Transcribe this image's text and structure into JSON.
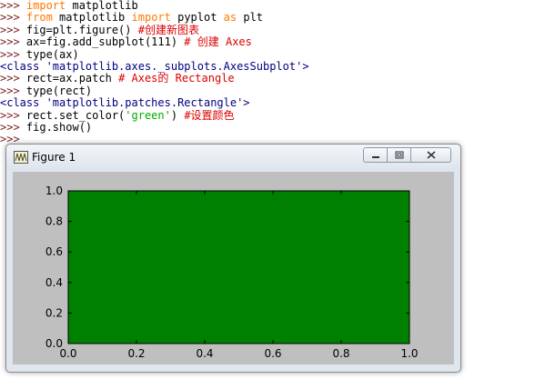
{
  "shell": {
    "prompt": ">>> ",
    "lines": [
      {
        "type": "in",
        "parts": [
          {
            "t": "import",
            "c": "kw"
          },
          {
            "t": " matplotlib",
            "c": ""
          }
        ]
      },
      {
        "type": "in",
        "parts": [
          {
            "t": "from",
            "c": "kw"
          },
          {
            "t": " matplotlib ",
            "c": ""
          },
          {
            "t": "import",
            "c": "kw"
          },
          {
            "t": " pyplot ",
            "c": ""
          },
          {
            "t": "as",
            "c": "kw"
          },
          {
            "t": " plt",
            "c": ""
          }
        ]
      },
      {
        "type": "in",
        "parts": [
          {
            "t": "fig=plt.figure() ",
            "c": ""
          },
          {
            "t": "#创建新图表",
            "c": "cm"
          }
        ]
      },
      {
        "type": "in",
        "parts": [
          {
            "t": "ax=fig.add_subplot(111) ",
            "c": ""
          },
          {
            "t": "# 创建 Axes",
            "c": "cm"
          }
        ]
      },
      {
        "type": "in",
        "parts": [
          {
            "t": "type(ax)",
            "c": ""
          }
        ]
      },
      {
        "type": "out",
        "parts": [
          {
            "t": "<class 'matplotlib.axes._subplots.AxesSubplot'>",
            "c": "out"
          }
        ]
      },
      {
        "type": "in",
        "parts": [
          {
            "t": "rect=ax.patch ",
            "c": ""
          },
          {
            "t": "# Axes的 Rectangle",
            "c": "cm"
          }
        ]
      },
      {
        "type": "in",
        "parts": [
          {
            "t": "type(rect)",
            "c": ""
          }
        ]
      },
      {
        "type": "out",
        "parts": [
          {
            "t": "<class 'matplotlib.patches.Rectangle'>",
            "c": "out"
          }
        ]
      },
      {
        "type": "in",
        "parts": [
          {
            "t": "rect.set_color(",
            "c": ""
          },
          {
            "t": "'green'",
            "c": "str"
          },
          {
            "t": ") ",
            "c": ""
          },
          {
            "t": "#设置颜色",
            "c": "cm"
          }
        ]
      },
      {
        "type": "in",
        "parts": [
          {
            "t": "fig.show()",
            "c": ""
          }
        ]
      },
      {
        "type": "in",
        "parts": []
      }
    ]
  },
  "window": {
    "title": "Figure 1",
    "icon": "matplotlib-wave-icon",
    "buttons": {
      "minimize": "minimize-icon",
      "maximize": "maximize-icon",
      "close": "close-icon"
    }
  },
  "chart_data": {
    "type": "area",
    "title": "",
    "xlabel": "",
    "ylabel": "",
    "xlim": [
      0.0,
      1.0
    ],
    "ylim": [
      0.0,
      1.0
    ],
    "x_ticks": [
      "0.0",
      "0.2",
      "0.4",
      "0.6",
      "0.8",
      "1.0"
    ],
    "y_ticks": [
      "0.0",
      "0.2",
      "0.4",
      "0.6",
      "0.8",
      "1.0"
    ],
    "axes_facecolor": "#008000",
    "figure_facecolor": "#bfbfbf",
    "grid": false
  }
}
